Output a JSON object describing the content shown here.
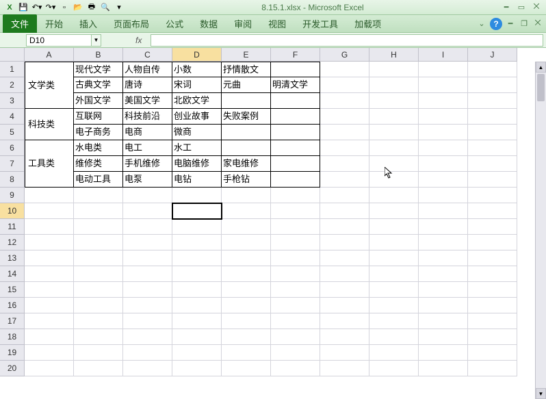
{
  "title": "8.15.1.xlsx - Microsoft Excel",
  "qat_icons": [
    "excel",
    "save",
    "undo",
    "redo",
    "new",
    "open",
    "print",
    "print-preview"
  ],
  "ribbon": {
    "file": "文件",
    "tabs": [
      "开始",
      "插入",
      "页面布局",
      "公式",
      "数据",
      "审阅",
      "视图",
      "开发工具",
      "加载项"
    ]
  },
  "name_box": "D10",
  "fx_label": "fx",
  "columns": [
    "A",
    "B",
    "C",
    "D",
    "E",
    "F",
    "G",
    "H",
    "I",
    "J"
  ],
  "rows": [
    1,
    2,
    3,
    4,
    5,
    6,
    7,
    8,
    9,
    10,
    11,
    12,
    13,
    14,
    15,
    16,
    17,
    18,
    19,
    20
  ],
  "active_cell": "D10",
  "selected_col": "D",
  "selected_row": 10,
  "merged": {
    "A1_A3": "文学类",
    "A4_A5": "科技类",
    "A6_A8": "工具类"
  },
  "cells": {
    "B1": "现代文学",
    "C1": "人物自传",
    "D1": "小数",
    "E1": "抒情散文",
    "B2": "古典文学",
    "C2": "唐诗",
    "D2": "宋词",
    "E2": "元曲",
    "F2": "明清文学",
    "B3": "外国文学",
    "C3": "美国文学",
    "D3": "北欧文学",
    "B4": "互联网",
    "C4": "科技前沿",
    "D4": "创业故事",
    "E4": "失败案例",
    "B5": "电子商务",
    "C5": "电商",
    "D5": "微商",
    "B6": "水电类",
    "C6": "电工",
    "D6": "水工",
    "B7": "维修类",
    "C7": "手机维修",
    "D7": "电脑维修",
    "E7": "家电维修",
    "B8": "电动工具",
    "C8": "电泵",
    "D8": "电钻",
    "E8": "手枪钻"
  }
}
